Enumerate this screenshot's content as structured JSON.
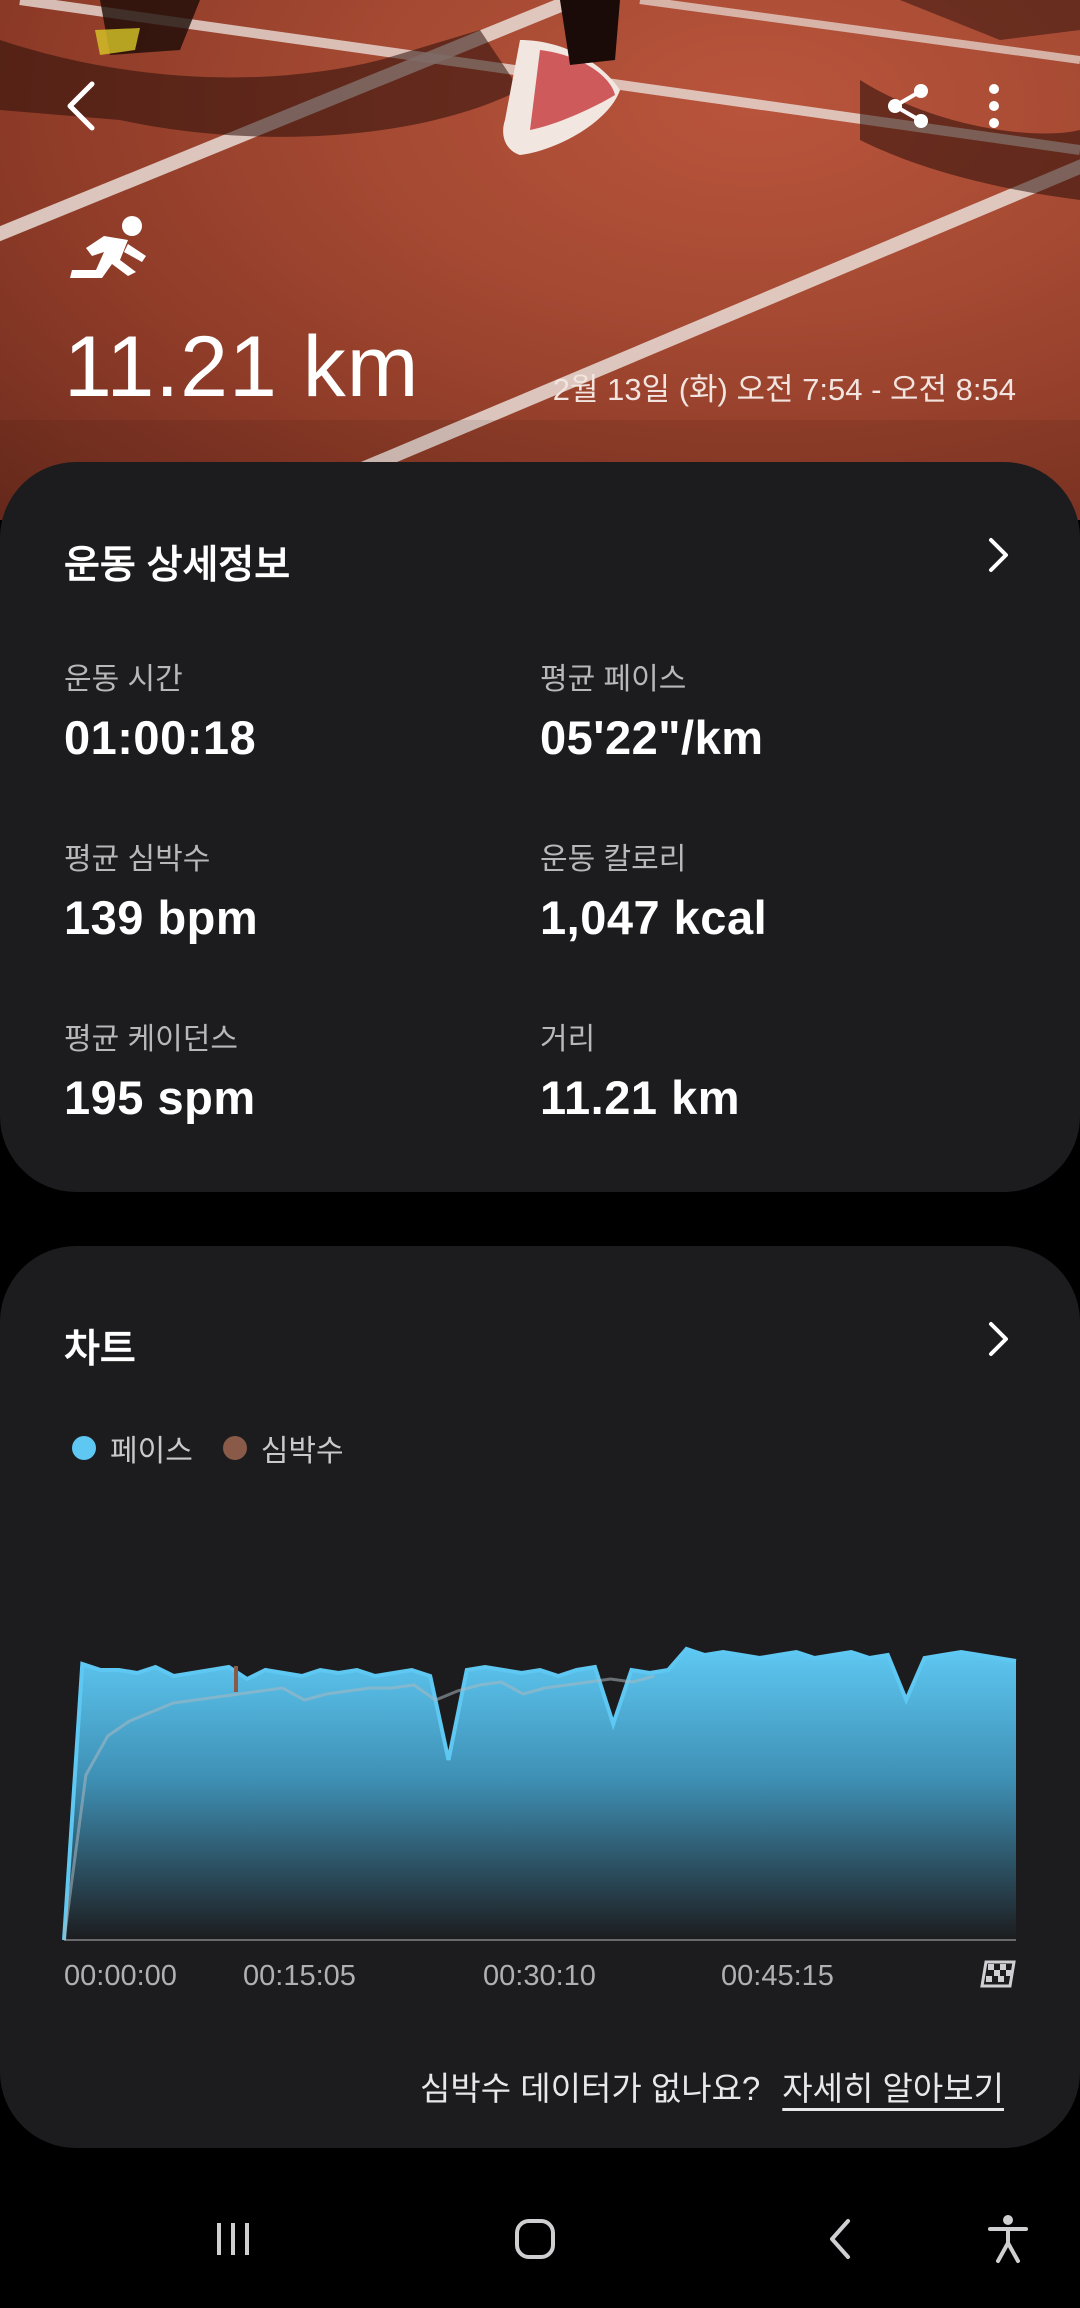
{
  "header": {
    "back_icon": "chevron-left-icon",
    "share_icon": "share-icon",
    "more_icon": "more-vertical-icon",
    "activity_icon": "running-icon",
    "distance": "11.21 km",
    "date_range": "2월 13일 (화) 오전 7:54 - 오전 8:54"
  },
  "details": {
    "title": "운동 상세정보",
    "stats": [
      {
        "label": "운동 시간",
        "value": "01:00:18"
      },
      {
        "label": "평균 페이스",
        "value": "05'22\"/km"
      },
      {
        "label": "평균 심박수",
        "value": "139 bpm"
      },
      {
        "label": "운동 칼로리",
        "value": "1,047 kcal"
      },
      {
        "label": "평균 케이던스",
        "value": "195 spm"
      },
      {
        "label": "거리",
        "value": "11.21 km"
      }
    ]
  },
  "chart": {
    "title": "차트",
    "legend": [
      {
        "label": "페이스",
        "color": "#5ec8f2"
      },
      {
        "label": "심박수",
        "color": "#8a5a48"
      }
    ],
    "x_ticks": [
      "00:00:00",
      "00:15:05",
      "00:30:10",
      "00:45:15"
    ],
    "finish_icon": "checkered-flag-icon",
    "help_text": "심박수 데이터가 없나요?",
    "help_link": "자세히 알아보기"
  },
  "chart_data": {
    "type": "area",
    "x_ticks": [
      "00:00:00",
      "00:15:05",
      "00:30:10",
      "00:45:15"
    ],
    "series": [
      {
        "name": "페이스",
        "values": [
          0.0,
          0.92,
          0.9,
          0.9,
          0.89,
          0.91,
          0.88,
          0.89,
          0.9,
          0.91,
          0.87,
          0.9,
          0.89,
          0.88,
          0.9,
          0.89,
          0.9,
          0.88,
          0.89,
          0.9,
          0.88,
          0.6,
          0.9,
          0.91,
          0.9,
          0.89,
          0.9,
          0.88,
          0.9,
          0.91,
          0.72,
          0.9,
          0.89,
          0.9,
          0.97,
          0.95,
          0.96,
          0.95,
          0.94,
          0.95,
          0.96,
          0.94,
          0.95,
          0.96,
          0.94,
          0.95,
          0.8,
          0.94,
          0.95,
          0.96,
          0.95,
          0.94,
          0.93
        ]
      },
      {
        "name": "심박수",
        "values": [
          0.0,
          0.55,
          0.68,
          0.73,
          0.76,
          0.79,
          0.8,
          0.81,
          0.82,
          0.83,
          0.84,
          0.8,
          0.82,
          0.83,
          0.84,
          0.84,
          0.85,
          0.8,
          0.83,
          0.85,
          0.86,
          0.82,
          0.84,
          0.85,
          0.86,
          0.87,
          0.86,
          0.88
        ]
      }
    ]
  },
  "navbar": {
    "recents_icon": "recents-icon",
    "home_icon": "home-icon",
    "back_icon": "back-icon",
    "accessibility_icon": "accessibility-icon"
  }
}
